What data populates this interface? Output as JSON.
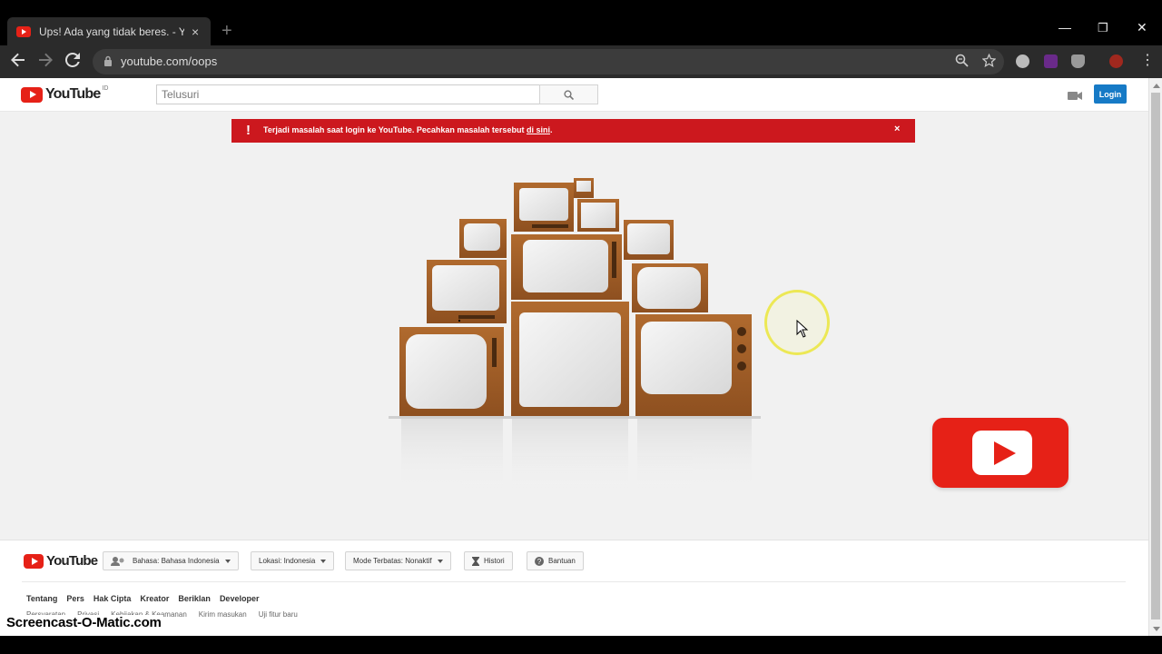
{
  "browser": {
    "tab_title": "Ups! Ada yang tidak beres. - YouTube",
    "tab_close": "×",
    "new_tab": "+",
    "minimize": "—",
    "restore": "❐",
    "close": "✕",
    "url": "youtube.com/oops"
  },
  "header": {
    "logo_text": "YouTube",
    "logo_region": "ID",
    "search_placeholder": "Telusuri",
    "login_label": "Login"
  },
  "alert": {
    "icon": "!",
    "message": "Terjadi masalah saat login ke YouTube. Pecahkan masalah tersebut ",
    "link": "di sini",
    "suffix": ".",
    "close": "×"
  },
  "footer": {
    "logo_text": "YouTube",
    "language": "Bahasa: Bahasa Indonesia",
    "location": "Lokasi: Indonesia",
    "restricted": "Mode Terbatas: Nonaktif",
    "history": "Histori",
    "help": "Bantuan",
    "links": [
      "Tentang",
      "Pers",
      "Hak Cipta",
      "Kreator",
      "Beriklan",
      "Developer"
    ],
    "links2": [
      "Persyaratan",
      "Privasi",
      "Kebijakan & Keamanan",
      "Kirim masukan",
      "Uji fitur baru"
    ]
  },
  "watermark": "Screencast-O-Matic.com",
  "colors": {
    "youtube_red": "#e62117",
    "alert_red": "#cc181e",
    "login_blue": "#167ac6"
  }
}
